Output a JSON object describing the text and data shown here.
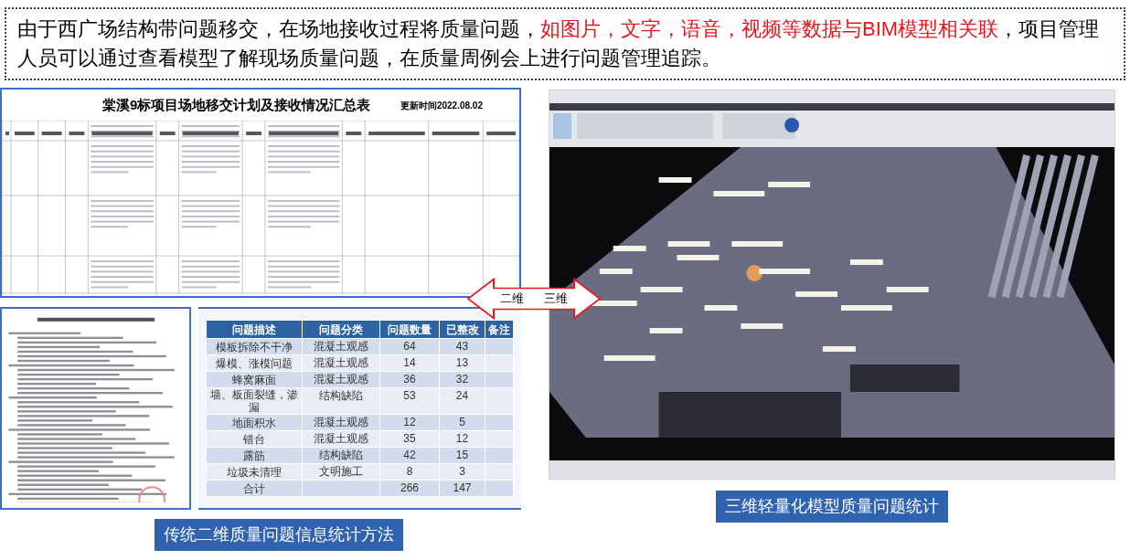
{
  "headline": {
    "segments": [
      {
        "text": "由于西广场结构带问题移交，在场地接收过程将质量问题，",
        "highlight": false
      },
      {
        "text": "如图片，文字，语音，视频等数据与BIM模型相关联",
        "highlight": true
      },
      {
        "text": "，项目管理人员可以通过查看模型了解现场质量问题，在质量周例会上进行问题管理追踪。",
        "highlight": false
      }
    ]
  },
  "spreadsheet": {
    "title": "棠溪9标项目场地移交计划及接收情况汇总表",
    "updated": "更新时间2022.08.02"
  },
  "arrow": {
    "left_label": "二维",
    "right_label": "三维"
  },
  "issue_table": {
    "columns": [
      "问题描述",
      "问题分类",
      "问题数量",
      "已整改",
      "备注"
    ],
    "rows": [
      {
        "description": "模板拆除不干净",
        "category": "混凝土观感",
        "count": "64",
        "fixed": "43"
      },
      {
        "description": "爆模、涨模问题",
        "category": "混凝土观感",
        "count": "14",
        "fixed": "13"
      },
      {
        "description": "蜂窝麻面",
        "category": "混凝土观感",
        "count": "36",
        "fixed": "32"
      },
      {
        "description": "墙、板面裂缝，渗漏",
        "category": "结构缺陷",
        "count": "53",
        "fixed": "24"
      },
      {
        "description": "地面积水",
        "category": "混凝土观感",
        "count": "12",
        "fixed": "5"
      },
      {
        "description": "错台",
        "category": "混凝土观感",
        "count": "35",
        "fixed": "12"
      },
      {
        "description": "露筋",
        "category": "结构缺陷",
        "count": "42",
        "fixed": "15"
      },
      {
        "description": "垃圾未清理",
        "category": "文明施工",
        "count": "8",
        "fixed": "3"
      },
      {
        "description": "合计",
        "count": "266",
        "fixed": "147"
      }
    ]
  },
  "captions": {
    "left": "传统二维质量问题信息统计方法",
    "right": "三维轻量化模型质量问题统计"
  }
}
